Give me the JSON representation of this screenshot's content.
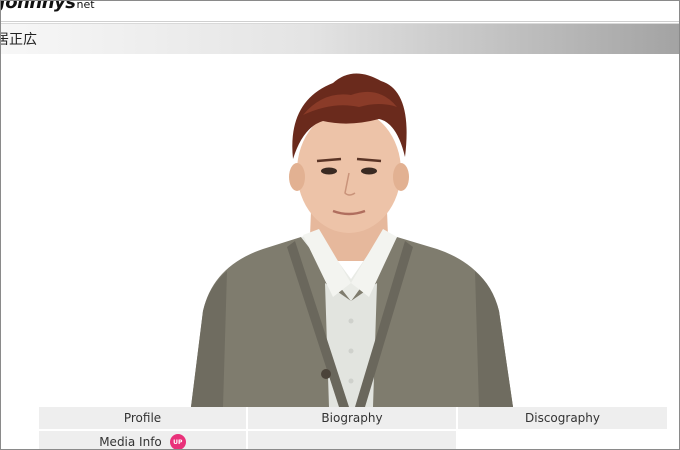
{
  "header": {
    "logo_text": "Johnnys",
    "logo_suffix": "net"
  },
  "name_bar": {
    "title": "居正広"
  },
  "photo": {
    "icon": "portrait-photo"
  },
  "nav": {
    "items": [
      {
        "label": "Profile"
      },
      {
        "label": "Biography"
      },
      {
        "label": "Discography"
      },
      {
        "label": "Media Info",
        "badge": "UP"
      }
    ]
  },
  "colors": {
    "badge": "#e9317a",
    "nav_bg": "#eeeeee"
  }
}
